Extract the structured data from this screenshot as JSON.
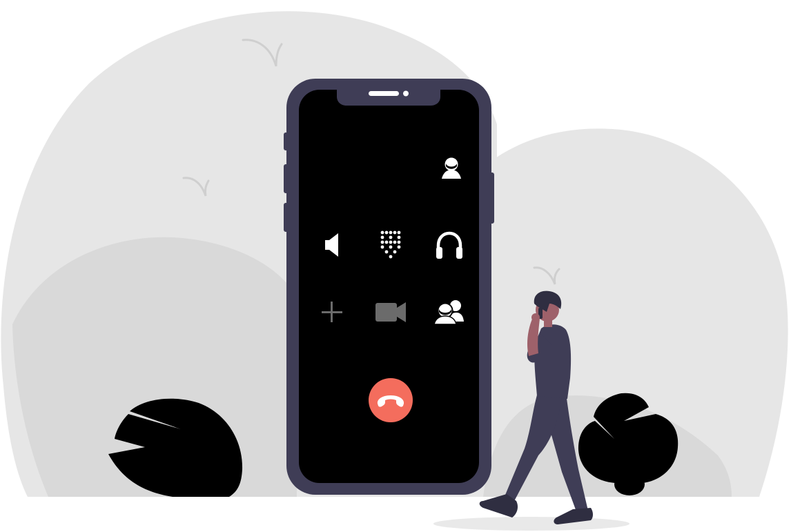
{
  "colors": {
    "background": "#ffffff",
    "hill_light": "#e6e6e6",
    "hill_mid": "#d9d9d9",
    "bird": "#cfcfcf",
    "phone_frame": "#3f3d56",
    "phone_screen": "#000000",
    "icon_active": "#ffffff",
    "icon_inactive": "#6b6b6b",
    "end_call": "#f46d5d",
    "bush": "#000000",
    "person_body": "#3f3d56",
    "person_skin": "#9e616a",
    "person_hair": "#2f2e41",
    "shadow": "#e9e9e9"
  },
  "phone": {
    "controls": [
      {
        "id": "contact",
        "icon": "contact-icon",
        "state": "active"
      },
      {
        "id": "speaker",
        "icon": "speaker-icon",
        "state": "active"
      },
      {
        "id": "keypad",
        "icon": "keypad-icon",
        "state": "active"
      },
      {
        "id": "headphones",
        "icon": "headphones-icon",
        "state": "active"
      },
      {
        "id": "add-call",
        "icon": "plus-icon",
        "state": "inactive"
      },
      {
        "id": "video",
        "icon": "video-camera-icon",
        "state": "inactive"
      },
      {
        "id": "conference",
        "icon": "group-icon",
        "state": "active"
      },
      {
        "id": "end-call",
        "icon": "phone-hangup-icon",
        "state": "active"
      }
    ]
  }
}
